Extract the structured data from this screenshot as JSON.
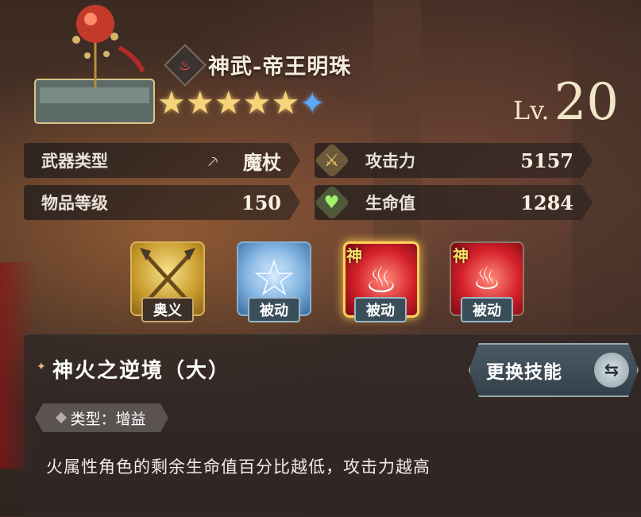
{
  "weapon": {
    "name": "神武-帝王明珠",
    "element_icon": "fire-icon",
    "stars": 5,
    "awaken_stars": 1,
    "level_prefix": "Lv.",
    "level": "20"
  },
  "stats": [
    {
      "label": "武器类型",
      "value": "魔杖",
      "icon": "staff-icon"
    },
    {
      "label": "攻击力",
      "value": "5157",
      "icon": "crossed-swords-icon"
    },
    {
      "label": "物品等级",
      "value": "150",
      "icon": ""
    },
    {
      "label": "生命值",
      "value": "1284",
      "icon": "heart-icon"
    }
  ],
  "skills": [
    {
      "tag": "奥义",
      "kind": "ultimate",
      "icon": "crossed-spears-icon"
    },
    {
      "tag": "被动",
      "kind": "passive",
      "icon": "star-icon"
    },
    {
      "tag": "被动",
      "kind": "passive-divine",
      "shen": "神",
      "icon": "fire-sword-icon",
      "selected": true
    },
    {
      "tag": "被动",
      "kind": "passive-divine",
      "shen": "神",
      "icon": "heart-sword-icon"
    }
  ],
  "detail": {
    "skill_name": "神火之逆境（大）",
    "type_text": "类型：增益",
    "description": "火属性角色的剩余生命值百分比越低，攻击力越高",
    "change_button": "更换技能"
  },
  "colors": {
    "gold": "#f6d478",
    "blue_star": "#5aa9ff",
    "fire": "#e53030"
  }
}
